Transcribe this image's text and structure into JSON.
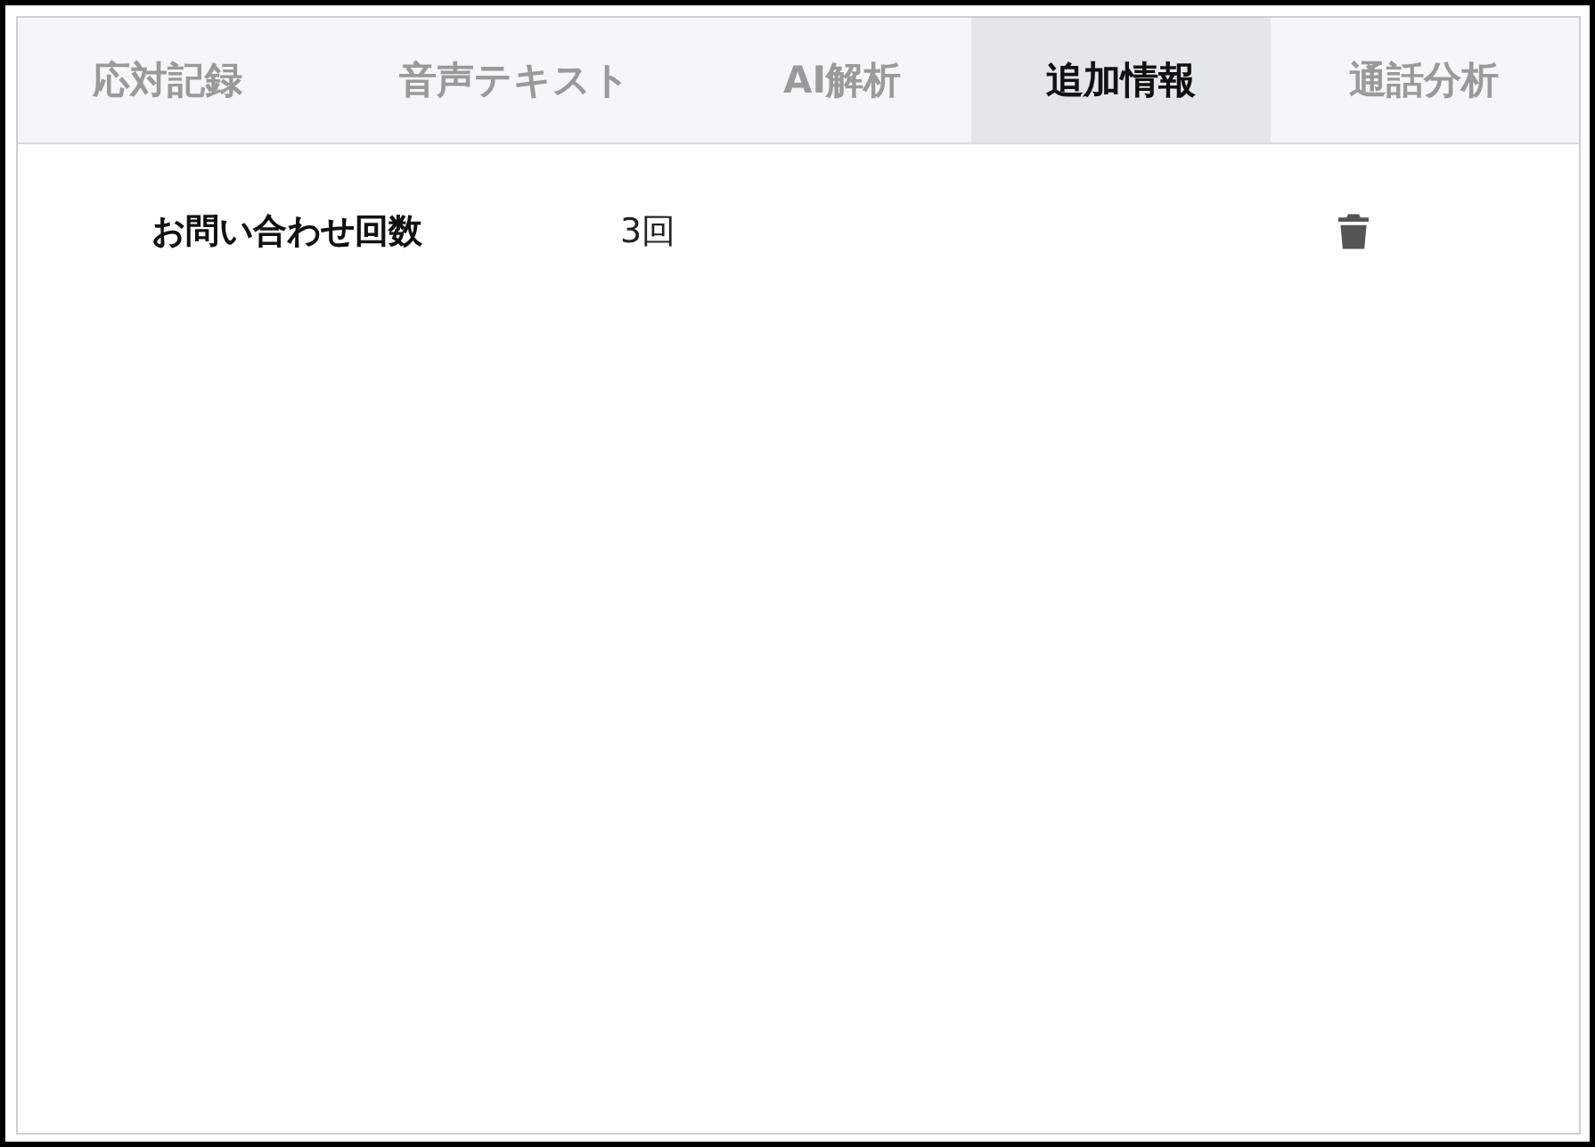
{
  "tabs": [
    {
      "label": "応対記録",
      "selected": false
    },
    {
      "label": "音声テキスト",
      "selected": false
    },
    {
      "label": "AI解析",
      "selected": false
    },
    {
      "label": "追加情報",
      "selected": true
    },
    {
      "label": "通話分析",
      "selected": false
    }
  ],
  "fields": [
    {
      "label": "お問い合わせ回数",
      "value": "3回"
    }
  ]
}
